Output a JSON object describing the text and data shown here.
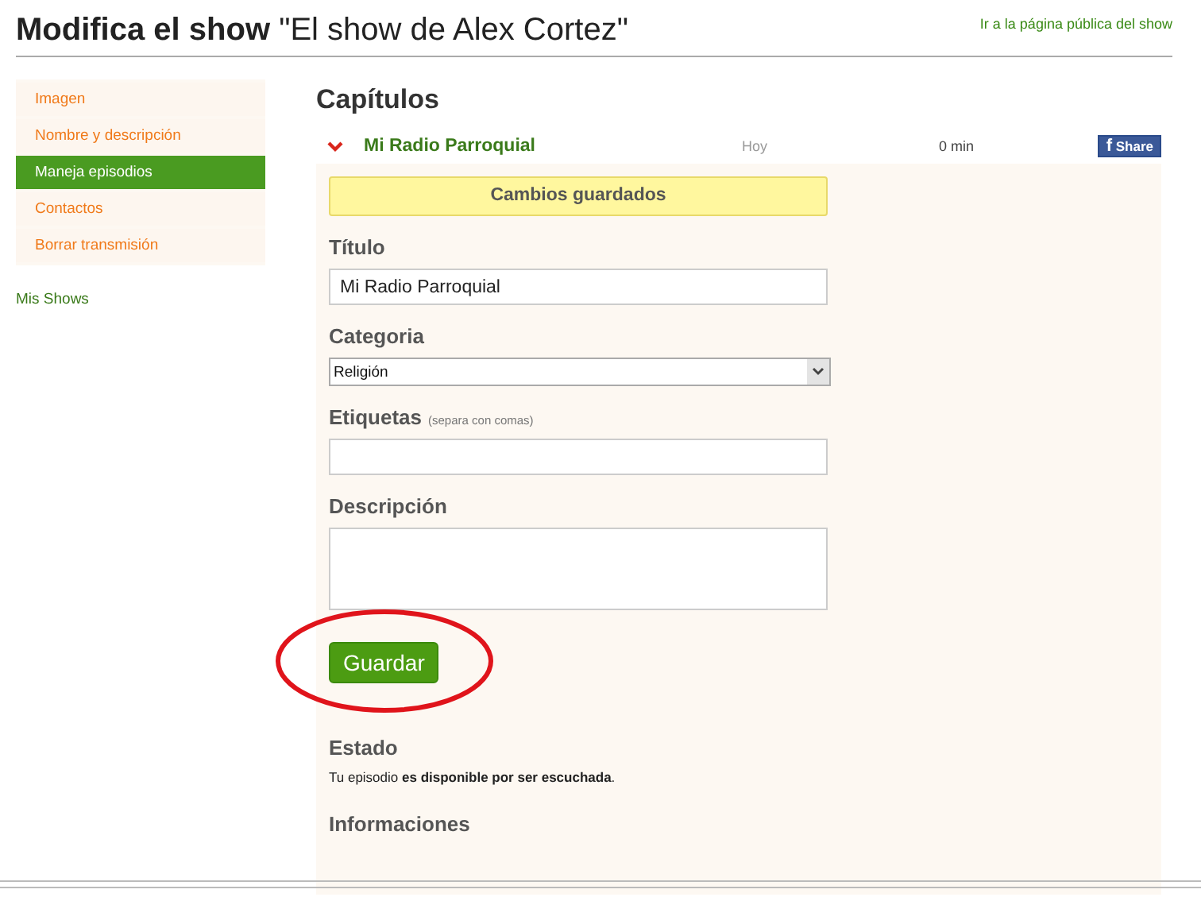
{
  "header": {
    "title": "**Modifica el show** \"El show de Alex Cortez\"",
    "public_link": "Ir a la página pública del show"
  },
  "sidebar": {
    "items": [
      {
        "label": "Imagen",
        "selected": false
      },
      {
        "label": "Nombre y descripción",
        "selected": false
      },
      {
        "label": "Maneja episodios",
        "selected": true
      },
      {
        "label": "Contactos",
        "selected": false
      },
      {
        "label": "Borrar transmisión",
        "selected": false
      }
    ],
    "link": "Mis Shows"
  },
  "main": {
    "heading": "Capítulos",
    "episode": {
      "title": "Mi Radio Parroquial",
      "date": "Hoy",
      "duration": "0 min",
      "expanded": true,
      "share": {
        "icon": "f",
        "label": "Share"
      }
    },
    "notice": "Cambios guardados",
    "fields": [
      {
        "kind": "text",
        "label": "Título",
        "value": "Mi Radio Parroquial"
      },
      {
        "kind": "select",
        "label": "Categoria",
        "value": "Religión"
      },
      {
        "kind": "text",
        "label": "Etiquetas",
        "hint": "(separa con comas)"
      },
      {
        "kind": "textarea",
        "label": "Descripción"
      }
    ],
    "save_button": "Guardar",
    "highlighted": true,
    "status": {
      "heading": "Estado",
      "text": "Tu episodio **es disponible por ser escuchada**."
    },
    "info_heading": "Informaciones"
  }
}
